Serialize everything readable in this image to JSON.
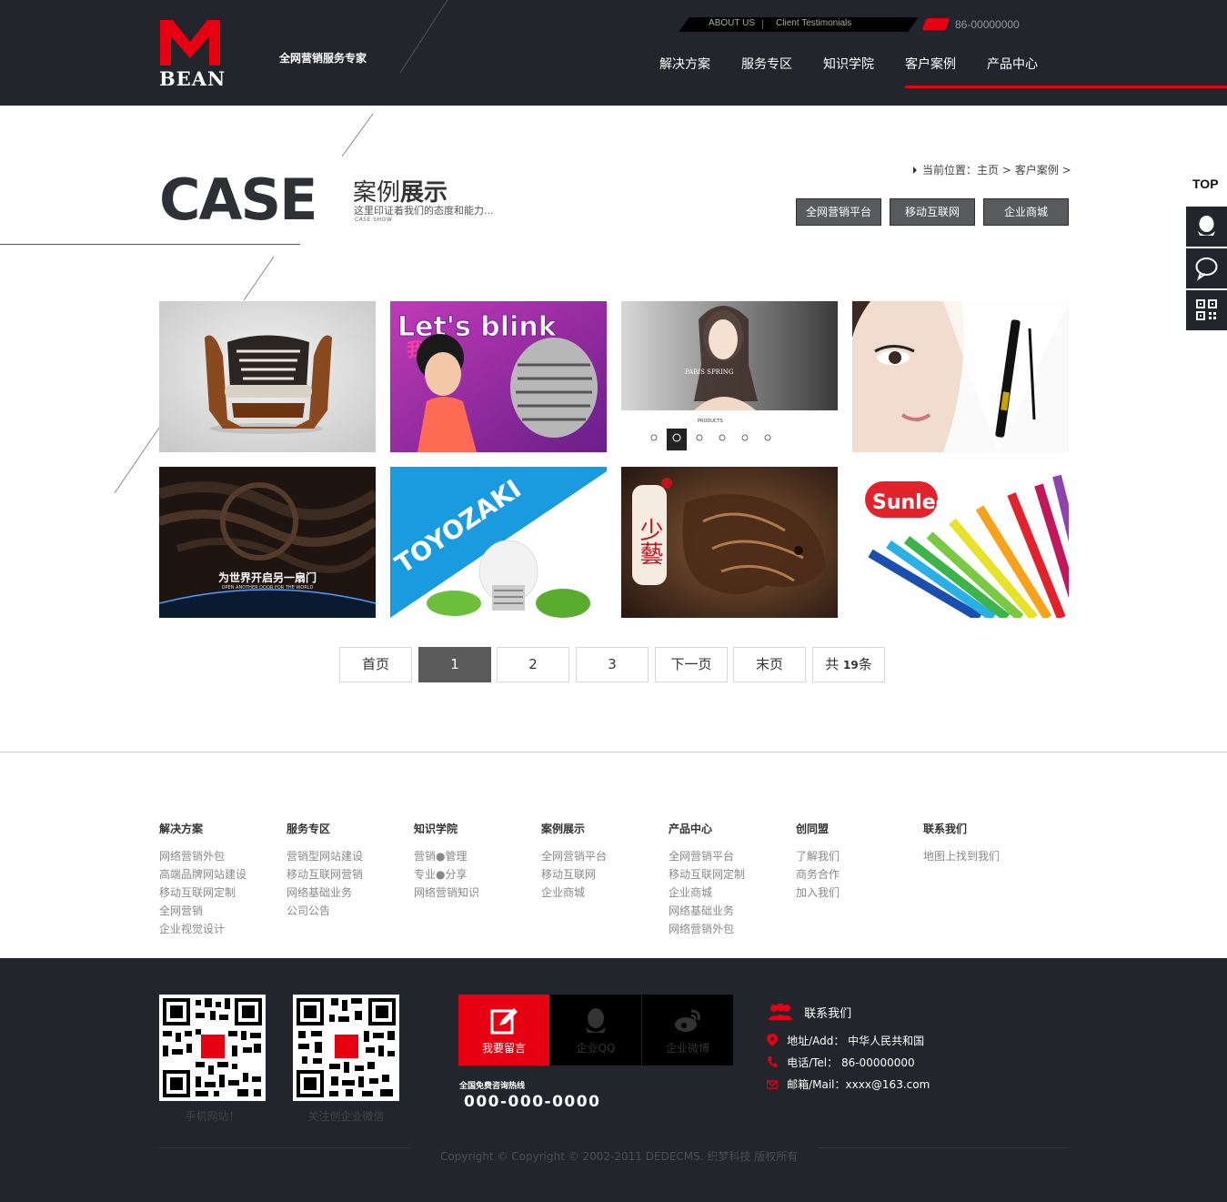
{
  "header": {
    "brand": "BEAN",
    "slogan": "全网营销服务专家",
    "toplinks": [
      "ABOUT US",
      "Client Testimonials"
    ],
    "phone": "86-00000000",
    "nav": [
      "解决方案",
      "服务专区",
      "知识学院",
      "客户案例",
      "产品中心"
    ],
    "active_nav": "客户案例"
  },
  "page": {
    "case_word": "CASE",
    "title_a": "案例",
    "title_b": "展示",
    "subtitle": "这里印证着我们的态度和能力...",
    "en_label": "CASE SHOW",
    "breadcrumb": {
      "prefix": "当前位置：",
      "home": "主页",
      "sep": ">",
      "current": "客户案例",
      "tail": ">"
    },
    "filters": [
      "全网营销平台",
      "移动互联网",
      "企业商城"
    ]
  },
  "cases": [
    {
      "name": "furniture-armchair"
    },
    {
      "name": "lets-blink",
      "text": "Let's blink"
    },
    {
      "name": "paris-jewelry",
      "text": "PARIS SPRING",
      "text2": "PRODUCTS"
    },
    {
      "name": "cosmetics-mascara"
    },
    {
      "name": "chocolate-door",
      "text": "为世界开启另一扇门",
      "text2": "OPEN ANOTHER DOOR FOR THE WORLD"
    },
    {
      "name": "toyozaki-lighting",
      "text": "TOYOZAKI"
    },
    {
      "name": "horse-carving",
      "text": "少藝"
    },
    {
      "name": "sunled-pencils",
      "text": "Sunled"
    }
  ],
  "pagination": {
    "items": [
      "首页",
      "1",
      "2",
      "3",
      "下一页",
      "末页"
    ],
    "active": "1",
    "total_prefix": "共",
    "total_count": "19",
    "total_suffix": "条"
  },
  "sitemap": [
    {
      "title": "解决方案",
      "links": [
        "网络营销外包",
        "高端品牌网站建设",
        "移动互联网定制",
        "全网营销",
        "企业视觉设计"
      ]
    },
    {
      "title": "服务专区",
      "links": [
        "营销型网站建设",
        "移动互联网营销",
        "网络基础业务",
        "公司公告"
      ]
    },
    {
      "title": "知识学院",
      "links": [
        "营销●管理",
        "专业●分享",
        "网络营销知识"
      ]
    },
    {
      "title": "案例展示",
      "links": [
        "全网营销平台",
        "移动互联网",
        "企业商城"
      ]
    },
    {
      "title": "产品中心",
      "links": [
        "全网营销平台",
        "移动互联网定制",
        "企业商城",
        "网络基础业务",
        "网络营销外包"
      ]
    },
    {
      "title": "创同盟",
      "links": [
        "了解我们",
        "商务合作",
        "加入我们"
      ]
    },
    {
      "title": "联系我们",
      "links": [
        "地图上找到我们"
      ]
    }
  ],
  "footer": {
    "qr1_caption": "手机网站！",
    "qr2_caption": "关注创企业微信",
    "buttons": [
      "我要留言",
      "企业QQ",
      "企业微博"
    ],
    "hotline_label": "全国免费咨询热线",
    "hotline": "000-000-0000",
    "contact_title": "联系我们",
    "address": "地址/Add： 中华人民共和国",
    "tel": "电话/Tel： 86-00000000",
    "mail": "邮箱/Mail：xxxx@163.com",
    "copyright": "Copyright © Copyright © 2002-2011 DEDECMS. 织梦科技 版权所有"
  },
  "side": {
    "top_label": "TOP"
  },
  "colors": {
    "accent": "#e60012",
    "dark": "#22252b",
    "active_page": "#5a5a5a"
  }
}
